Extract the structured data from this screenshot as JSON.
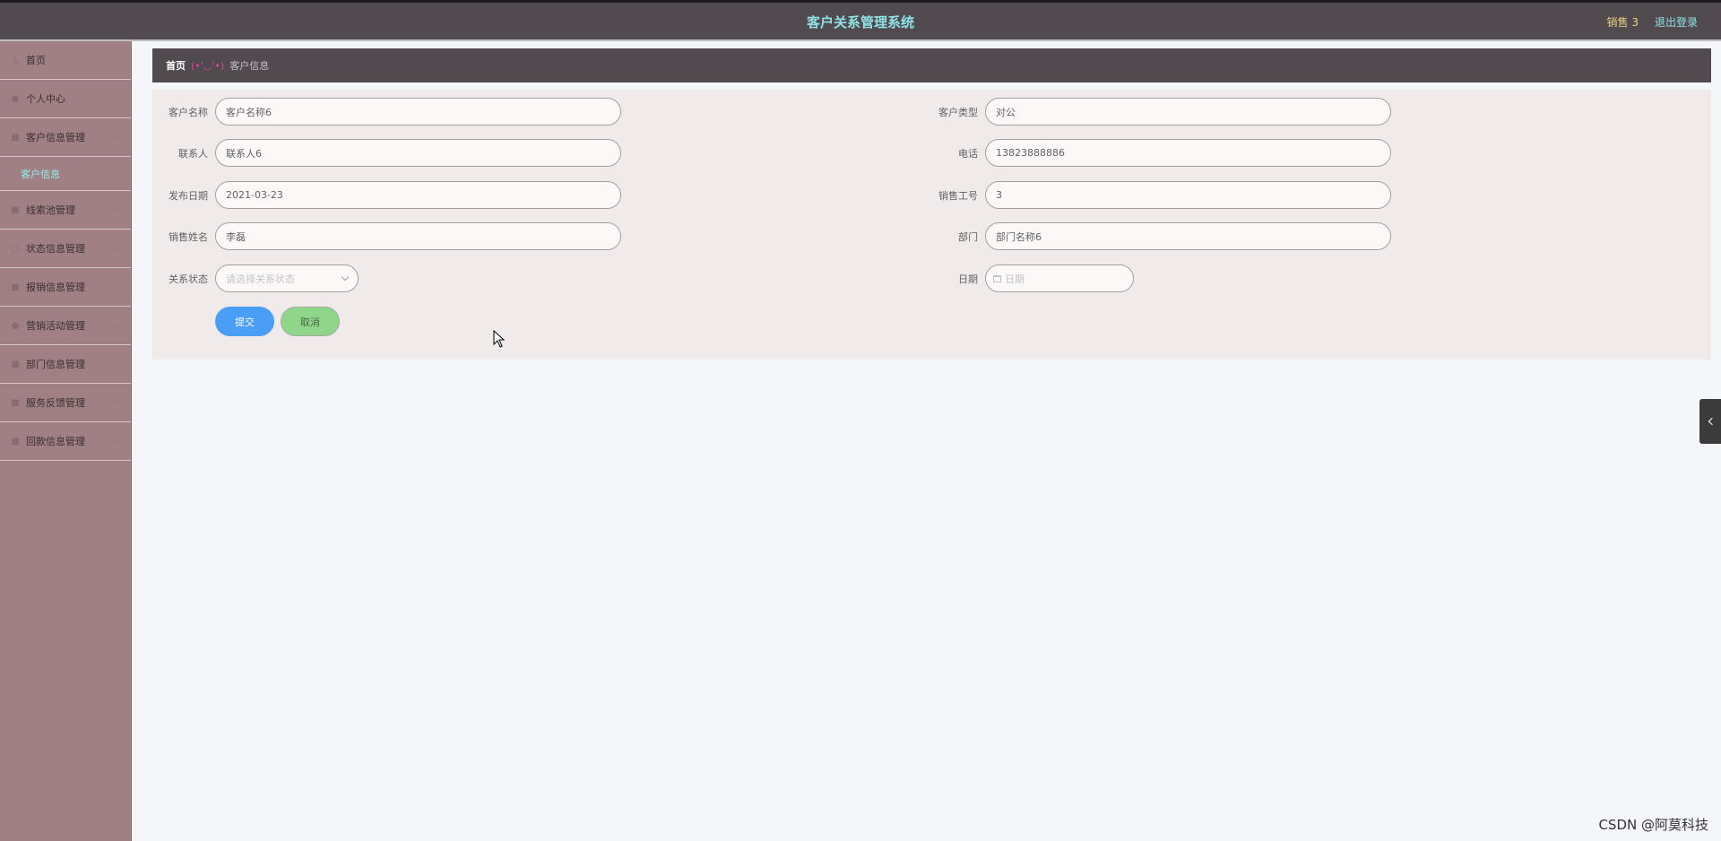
{
  "header": {
    "title": "客户关系管理系统",
    "user_label": "销售 3",
    "logout_label": "退出登录"
  },
  "sidebar": {
    "items": [
      {
        "label": "首页",
        "icon": "home-icon"
      },
      {
        "label": "个人中心",
        "icon": "user-icon"
      },
      {
        "label": "客户信息管理",
        "icon": "grid-icon"
      },
      {
        "label": "线索池管理",
        "icon": "grid-icon"
      },
      {
        "label": "状态信息管理",
        "icon": "circle-icon"
      },
      {
        "label": "报销信息管理",
        "icon": "grid-icon"
      },
      {
        "label": "营销活动管理",
        "icon": "user-icon"
      },
      {
        "label": "部门信息管理",
        "icon": "grid-icon"
      },
      {
        "label": "服务反馈管理",
        "icon": "grid-icon"
      },
      {
        "label": "回款信息管理",
        "icon": "grid-icon"
      }
    ],
    "active_sub_item": "客户信息"
  },
  "breadcrumb": {
    "home": "首页",
    "separator": "(•'◡'•)",
    "current": "客户信息"
  },
  "form": {
    "customer_name": {
      "label": "客户名称",
      "value": "客户名称6"
    },
    "customer_type": {
      "label": "客户类型",
      "value": "对公"
    },
    "contact": {
      "label": "联系人",
      "value": "联系人6"
    },
    "phone": {
      "label": "电话",
      "value": "13823888886"
    },
    "publish_date": {
      "label": "发布日期",
      "value": "2021-03-23"
    },
    "sales_id": {
      "label": "销售工号",
      "value": "3"
    },
    "sales_name": {
      "label": "销售姓名",
      "value": "李磊"
    },
    "department": {
      "label": "部门",
      "value": "部门名称6"
    },
    "relation_status": {
      "label": "关系状态",
      "placeholder": "请选择关系状态"
    },
    "date": {
      "label": "日期",
      "placeholder": "日期"
    },
    "submit_label": "提交",
    "cancel_label": "取消"
  },
  "watermark": "CSDN @阿莫科技",
  "colors": {
    "header_bg": "#514a4e",
    "title_color": "#8fe3e7",
    "sidebar_bg": "#a08084",
    "submit_bg": "#4a9ef5",
    "cancel_bg": "#8fd58a",
    "panel_bg": "#f1eaea"
  }
}
